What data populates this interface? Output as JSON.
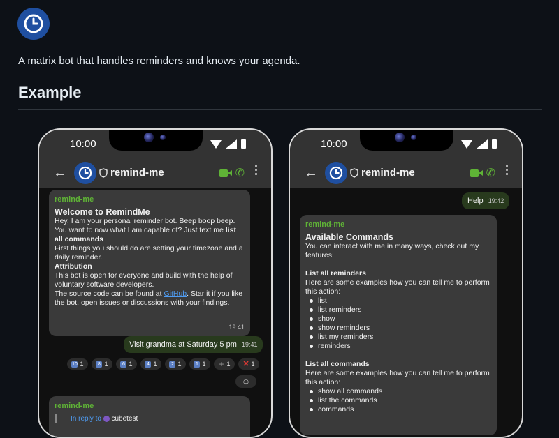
{
  "page": {
    "tagline": "A matrix bot that handles reminders and knows your agenda.",
    "heading": "Example",
    "logo_icon": "clock-icon"
  },
  "phone_left": {
    "status": {
      "time": "10:00"
    },
    "room": {
      "name": "remind-me"
    },
    "welcome": {
      "sender": "remind-me",
      "title": "Welcome to RemindMe",
      "line1": "Hey, I am your personal reminder bot. Beep boop beep.",
      "line2": "You want to now what I am capable of? Just text me",
      "cmd": "list all commands",
      "line3": "First things you should do are setting your timezone and a daily reminder.",
      "attr_title": "Attribution",
      "line4": "This bot is open for everyone and build with the help of voluntary software developers.",
      "line5_pre": "The source code can be found at",
      "link": "GitHub",
      "line5_post": ". Star it if you like the bot, open issues or discussions with your findings.",
      "time": "19:41"
    },
    "outgoing": {
      "text": "Visit grandma at Saturday 5 pm",
      "time": "19:41"
    },
    "reactions": [
      {
        "emoji": "10",
        "count": "1"
      },
      {
        "emoji": "8",
        "count": "1"
      },
      {
        "emoji": "6",
        "count": "1"
      },
      {
        "emoji": "4",
        "count": "1"
      },
      {
        "emoji": "2",
        "count": "1"
      },
      {
        "emoji": "1",
        "count": "1"
      },
      {
        "emoji": "+",
        "count": "1"
      },
      {
        "emoji": "✕",
        "count": "1"
      }
    ],
    "reply_msg": {
      "sender": "remind-me",
      "in_reply_to": "In reply to",
      "user": "cubetest"
    }
  },
  "phone_right": {
    "status": {
      "time": "10:00"
    },
    "room": {
      "name": "remind-me"
    },
    "outgoing": {
      "text": "Help",
      "time": "19:42"
    },
    "commands": {
      "sender": "remind-me",
      "title": "Available Commands",
      "intro": "You can interact with me in many ways, check out my features:",
      "section1_title": "List all reminders",
      "section1_desc": "Here are some examples how you can tell me to perform this action:",
      "section1_items": [
        "list",
        "list reminders",
        "show",
        "show reminders",
        "list my reminders",
        "reminders"
      ],
      "section2_title": "List all commands",
      "section2_desc": "Here are some examples how you can tell me to perform this action:",
      "section2_items": [
        "show all commands",
        "list the commands",
        "commands"
      ]
    }
  },
  "colors": {
    "accent_green": "#5fb336",
    "link_blue": "#4f9cf2",
    "brand_blue": "#1f4fa0"
  }
}
